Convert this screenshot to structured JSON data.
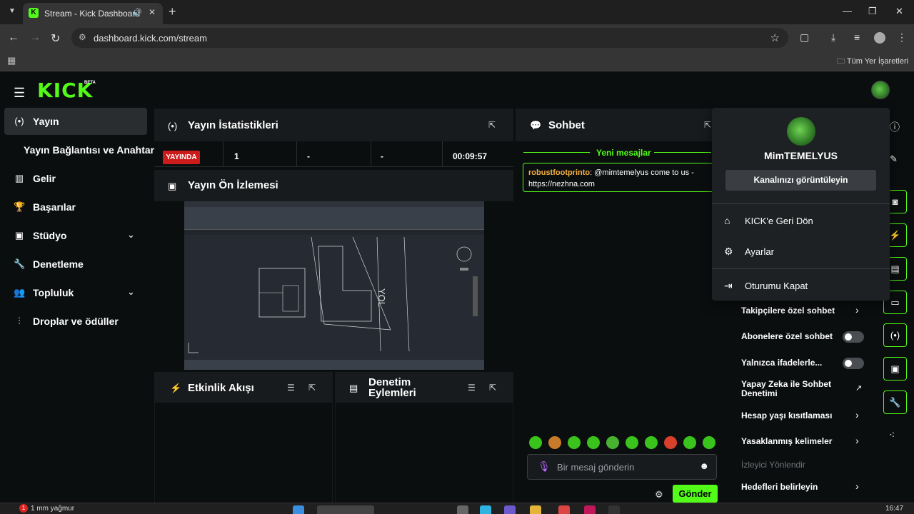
{
  "browser": {
    "tab_title": "Stream - Kick Dashboard",
    "url": "dashboard.kick.com/stream",
    "bookmarks_label": "Tüm Yer İşaretleri"
  },
  "header": {
    "logo": "KICK",
    "logo_badge": "BETA"
  },
  "sidebar": {
    "items": [
      {
        "label": "Yayın",
        "icon": "broadcast-icon"
      },
      {
        "label": "Yayın Bağlantısı ve Anahtarı"
      },
      {
        "label": "Gelir",
        "icon": "chart-icon"
      },
      {
        "label": "Başarılar",
        "icon": "trophy-icon"
      },
      {
        "label": "Stüdyo",
        "icon": "studio-icon"
      },
      {
        "label": "Denetleme",
        "icon": "wrench-icon"
      },
      {
        "label": "Topluluk",
        "icon": "community-icon"
      },
      {
        "label": "Droplar ve ödüller",
        "icon": "drops-icon"
      }
    ]
  },
  "stats": {
    "title": "Yayın İstatistikleri",
    "status": "YAYINDA",
    "values": [
      "1",
      "-",
      "-",
      "00:09:57"
    ]
  },
  "preview": {
    "title": "Yayın Ön İzlemesi",
    "overlay_text": "YOL"
  },
  "activity": {
    "title": "Etkinlik Akışı"
  },
  "moderation": {
    "title": "Denetim Eylemleri"
  },
  "chat": {
    "title": "Sohbet",
    "new_messages": "Yeni mesajlar",
    "message_user": "robustfootprinto",
    "message_text": ": @mimtemelyus come to us - https://nezhna.com",
    "input_placeholder": "Bir mesaj gönderin",
    "send_label": "Gönder"
  },
  "chat_settings": {
    "items": [
      {
        "label": "Takipçilere özel sohbet",
        "control": "chevron"
      },
      {
        "label": "Abonelere özel sohbet",
        "control": "toggle"
      },
      {
        "label": "Yalnızca ifadelerle...",
        "control": "toggle"
      },
      {
        "label": "Yapay Zeka ile Sohbet Denetimi",
        "control": "external"
      },
      {
        "label": "Hesap yaşı kısıtlaması",
        "control": "chevron"
      },
      {
        "label": "Yasaklanmış kelimeler",
        "control": "chevron"
      },
      {
        "label": "İzleyici Yönlendir",
        "control": "none"
      },
      {
        "label": "Hedefleri belirleyin",
        "control": "chevron"
      }
    ]
  },
  "dropdown": {
    "username": "MimTEMELYUS",
    "view_channel": "Kanalınızı görüntüleyin",
    "items": [
      {
        "label": "KICK'e Geri Dön",
        "icon": "home-icon"
      },
      {
        "label": "Ayarlar",
        "icon": "gear-icon"
      },
      {
        "label": "Oturumu Kapat",
        "icon": "logout-icon"
      }
    ]
  },
  "taskbar": {
    "weather_badge": "1",
    "weather": "1 mm yağmur",
    "time": "16:47"
  },
  "colors": {
    "accent": "#53fc18",
    "live": "#cc1b1b",
    "panel": "#181b1d",
    "background": "#0b0e0f"
  }
}
